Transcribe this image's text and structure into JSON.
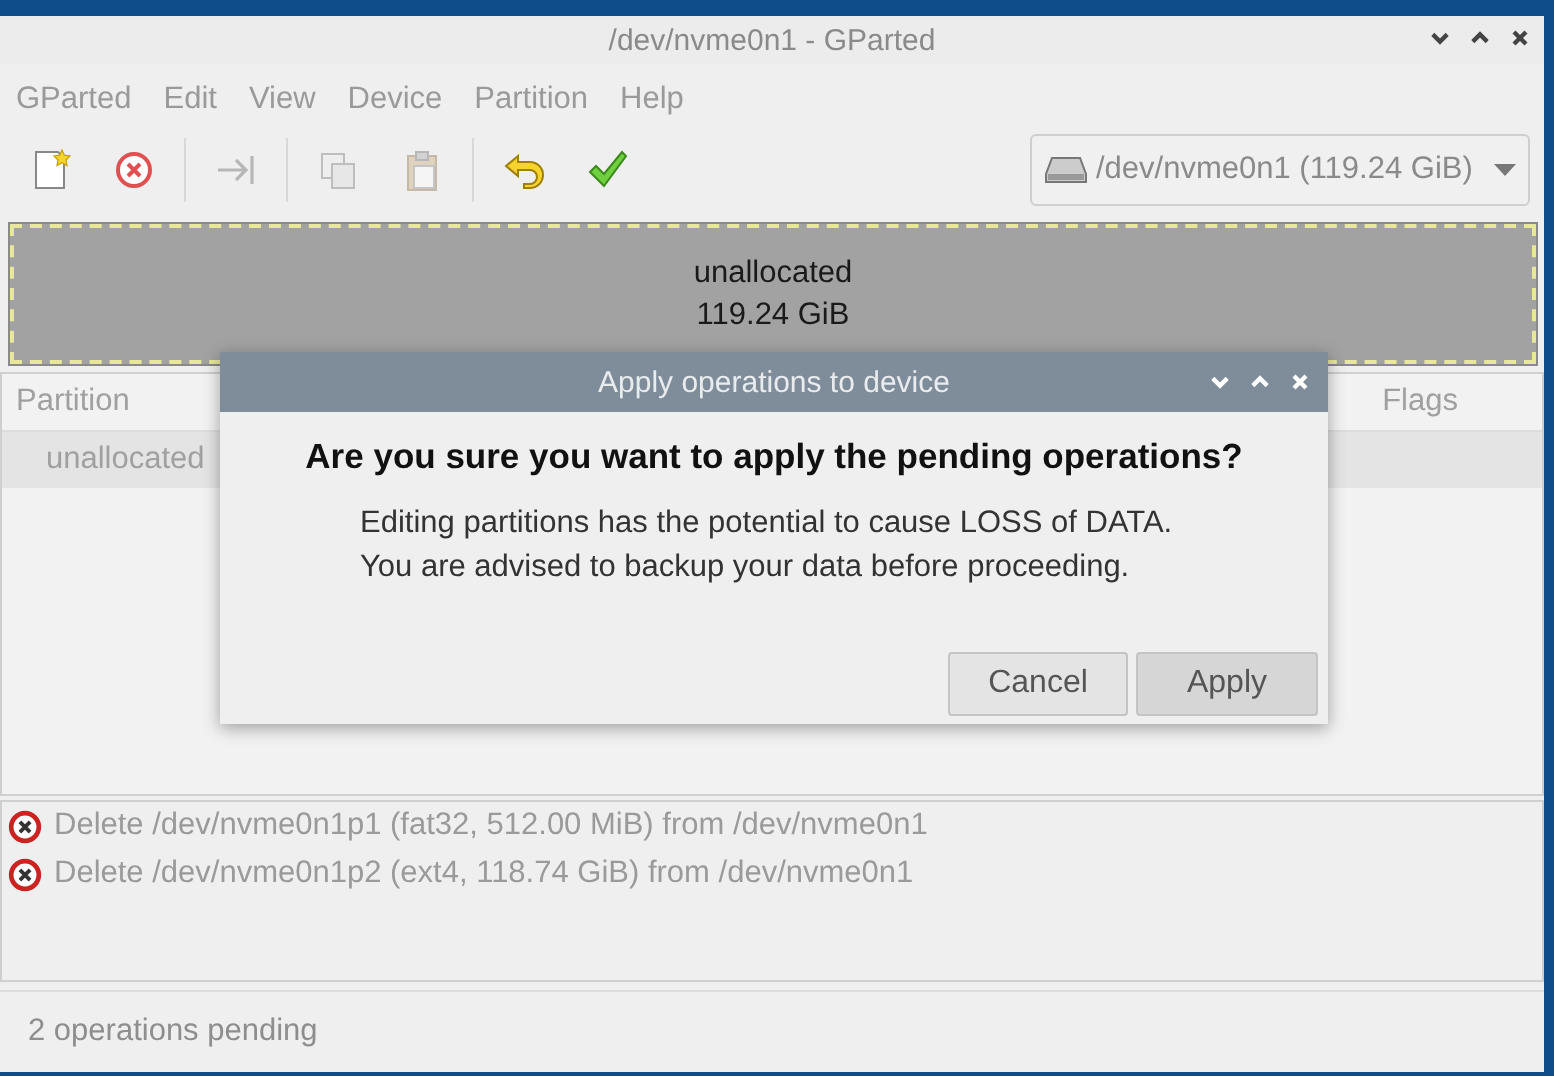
{
  "window": {
    "title": "/dev/nvme0n1 - GParted"
  },
  "menu": [
    "GParted",
    "Edit",
    "View",
    "Device",
    "Partition",
    "Help"
  ],
  "toolbar": [
    {
      "kind": "new",
      "disabled": false
    },
    {
      "kind": "delete",
      "disabled": false
    },
    {
      "kind": "resize",
      "disabled": true
    },
    {
      "kind": "copy",
      "disabled": true
    },
    {
      "kind": "paste",
      "disabled": true
    },
    {
      "kind": "undo",
      "disabled": false
    },
    {
      "kind": "apply",
      "disabled": false
    }
  ],
  "device_selector": {
    "value": "/dev/nvme0n1 (119.24 GiB)"
  },
  "disk_graph": {
    "label": "unallocated",
    "size": "119.24 GiB"
  },
  "table": {
    "columns": [
      "Partition",
      "Flags"
    ],
    "rows": [
      {
        "partition": "unallocated",
        "selected": true
      }
    ]
  },
  "operations": [
    "Delete /dev/nvme0n1p1 (fat32, 512.00 MiB) from /dev/nvme0n1",
    "Delete /dev/nvme0n1p2 (ext4, 118.74 GiB) from /dev/nvme0n1"
  ],
  "status_bar": "2 operations pending",
  "dialog": {
    "title": "Apply operations to device",
    "heading": "Are you sure you want to apply the pending operations?",
    "message": [
      "Editing partitions has the potential to cause LOSS of DATA.",
      "You are advised to backup your data before proceeding."
    ],
    "buttons": [
      {
        "label": "Cancel",
        "kind": "cancel"
      },
      {
        "label": "Apply",
        "kind": "default"
      }
    ]
  }
}
